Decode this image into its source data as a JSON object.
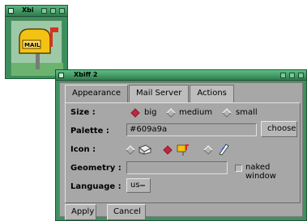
{
  "mini_window": {
    "title": "Xbi",
    "mail_icon_text": "MAIL"
  },
  "main_window": {
    "title": "Xbiff 2",
    "tabs": [
      {
        "label": "Appearance"
      },
      {
        "label": "Mail Server"
      },
      {
        "label": "Actions"
      }
    ],
    "size": {
      "label": "Size :",
      "options": [
        "big",
        "medium",
        "small"
      ],
      "selected": "big"
    },
    "palette": {
      "label": "Palette :",
      "value": "#609a9a",
      "button": "choose"
    },
    "icon": {
      "label": "Icon :",
      "selected_index": 1
    },
    "geometry": {
      "label": "Geometry :",
      "value": "",
      "checkbox_label": "naked window"
    },
    "language": {
      "label": "Language :",
      "value": "us"
    },
    "buttons": {
      "apply": "Apply",
      "cancel": "Cancel"
    }
  },
  "colors": {
    "window_green": "#3f915f",
    "panel_gray": "#a7a7a7",
    "selection_red": "#c02640"
  }
}
